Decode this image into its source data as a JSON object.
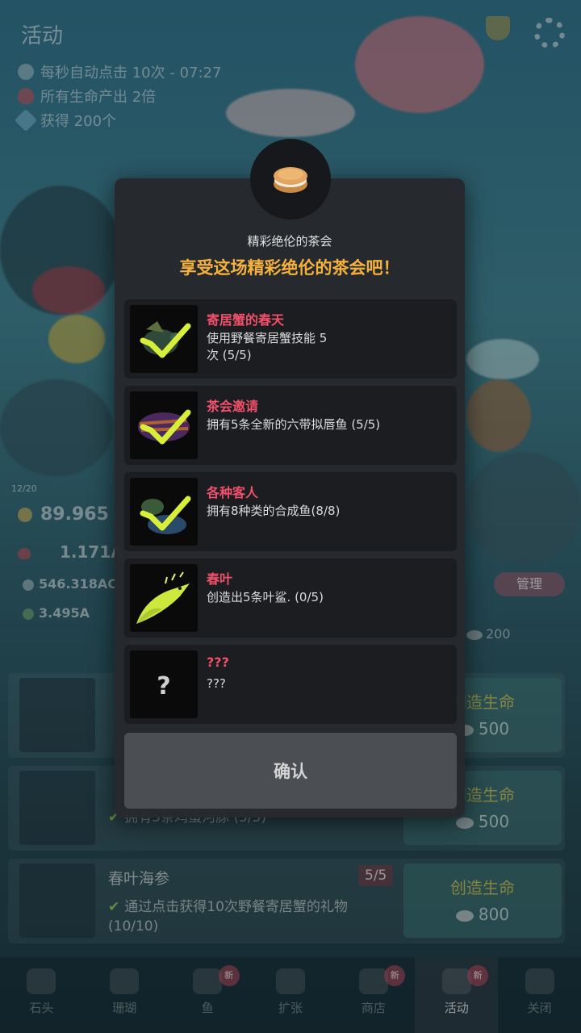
{
  "background": {
    "tab_title": "活动",
    "buffs": [
      {
        "icon": "auto-tap-icon",
        "text": "每秒自动点击 10次 - 07:27"
      },
      {
        "icon": "heart-icon",
        "text": "所有生命产出 2倍"
      },
      {
        "icon": "gem-icon",
        "text": "获得 200个"
      }
    ],
    "level_label": "12/20",
    "currency_main": "89.965",
    "currency_second": "1.171A",
    "tap_value": "546.318AC",
    "fish_value": "3.495A",
    "manage_button": "管理",
    "cost_partial": "200",
    "rows": [
      {
        "name": "",
        "progress": "",
        "desc": "",
        "create_label": "创造生命",
        "cost": "500"
      },
      {
        "name": "",
        "progress": "",
        "desc": "拥有5条鸡蛋河豚 (5/5)",
        "create_label": "创造生命",
        "cost": "500"
      },
      {
        "name": "春叶海参",
        "progress": "5/5",
        "desc": "通过点击获得10次野餐寄居蟹的礼物 (10/10)",
        "create_label": "创造生命",
        "cost": "800"
      }
    ],
    "nav": [
      {
        "label": "石头",
        "icon": "rock-icon",
        "badge": ""
      },
      {
        "label": "珊瑚",
        "icon": "coral-icon",
        "badge": ""
      },
      {
        "label": "鱼",
        "icon": "fish-icon",
        "badge": "新"
      },
      {
        "label": "扩张",
        "icon": "expand-icon",
        "badge": ""
      },
      {
        "label": "商店",
        "icon": "cart-icon",
        "badge": "新"
      },
      {
        "label": "活动",
        "icon": "event-icon",
        "badge": "新"
      },
      {
        "label": "关闭",
        "icon": "close-icon",
        "badge": ""
      }
    ]
  },
  "modal": {
    "subtitle": "精彩绝伦的茶会",
    "title": "享受这场精彩绝伦的茶会吧！",
    "missions": [
      {
        "name": "寄居蟹的春天",
        "desc": "使用野餐寄居蟹技能 5次 (5/5)",
        "completed": true
      },
      {
        "name": "茶会邀请",
        "desc": "拥有5条全新的六带拟唇鱼 (5/5)",
        "completed": true
      },
      {
        "name": "各种客人",
        "desc": "拥有8种类的合成鱼(8/8)",
        "completed": true
      },
      {
        "name": "春叶",
        "desc": "创造出5条叶鲨. (0/5)",
        "completed": false
      },
      {
        "name": "???",
        "desc": "???",
        "completed": false
      }
    ],
    "confirm_label": "确认",
    "colors": {
      "title": "#f5b13c",
      "mission_name": "#f0506a",
      "check": "#d8ef3a"
    }
  }
}
